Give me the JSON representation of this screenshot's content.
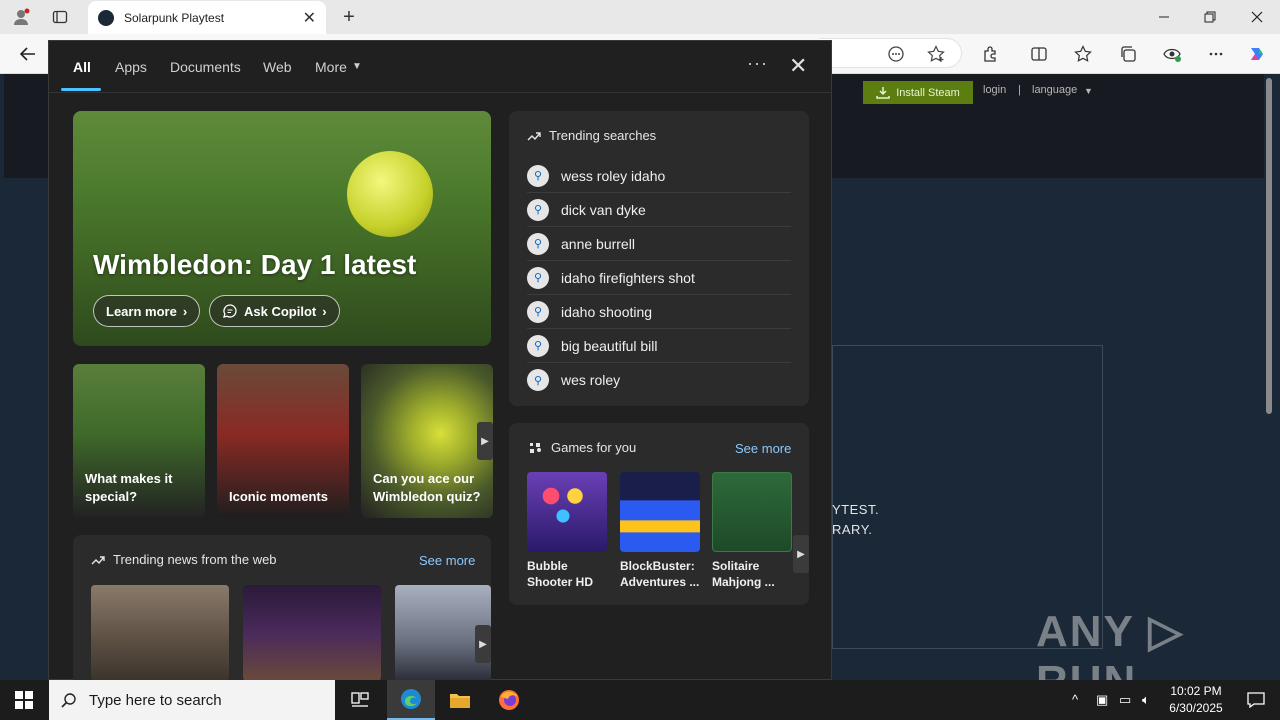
{
  "browser": {
    "tab_title": "Solarpunk Playtest",
    "tab_close": "✕",
    "new_tab": "+"
  },
  "steam": {
    "install_label": "Install Steam",
    "login_label": "login",
    "separator": "|",
    "language_label": "language",
    "body_line1": "YTEST.",
    "body_line2": "RARY.",
    "watermark": "ANY ▷ RUN"
  },
  "flyout": {
    "tabs": [
      "All",
      "Apps",
      "Documents",
      "Web",
      "More"
    ],
    "hero": {
      "headline": "Wimbledon: Day 1 latest",
      "learn_more": "Learn more",
      "ask_copilot": "Ask Copilot"
    },
    "thumbs": [
      {
        "caption": "What makes it special?"
      },
      {
        "caption": "Iconic moments"
      },
      {
        "caption": "Can you ace our Wimbledon quiz?"
      }
    ],
    "news": {
      "title": "Trending news from the web",
      "see_more": "See more"
    },
    "trending": {
      "title": "Trending searches",
      "items": [
        "wess roley idaho",
        "dick van dyke",
        "anne burrell",
        "idaho firefighters shot",
        "idaho shooting",
        "big beautiful bill",
        "wes roley"
      ]
    },
    "games": {
      "title": "Games for you",
      "see_more": "See more",
      "items": [
        {
          "name": "Bubble Shooter HD"
        },
        {
          "name": "BlockBuster: Adventures ..."
        },
        {
          "name": "Solitaire Mahjong ..."
        }
      ]
    }
  },
  "taskbar": {
    "search_placeholder": "Type here to search",
    "time": "10:02 PM",
    "date": "6/30/2025"
  },
  "colors": {
    "accent": "#4cc2ff",
    "steam_green": "#5c7e10",
    "steam_bg": "#1b2838",
    "flyout_bg": "#202020"
  }
}
